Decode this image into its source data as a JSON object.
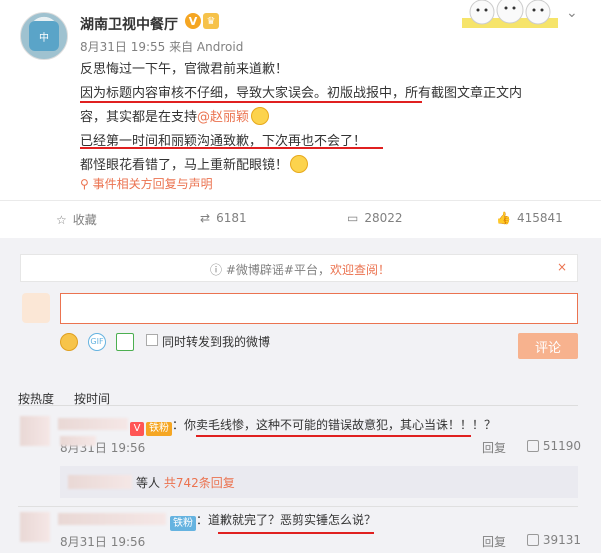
{
  "header": {
    "account_name": "湖南卫视中餐厅",
    "verified_badge": "V",
    "meta": "8月31日 19:55 来自 Android",
    "menu_icon": "chevron-down-icon"
  },
  "post": {
    "lines": [
      "反思悔过一下午，官微君前来道歉！",
      "因为标题内容审核不仔细，导致大家误会。初版战报中，所有截图文章正文内",
      "容，其实都是在支持",
      "已经第一时间和丽颖沟通致歉，下次再也不会了！",
      "都怪眼花看错了，马上重新配眼镜！"
    ],
    "mention": "@赵丽颖",
    "related_link": "事件相关方回复与声明"
  },
  "actions": {
    "favorite": "收藏",
    "repost": "6181",
    "comments": "28022",
    "likes": "415841"
  },
  "notice": {
    "prefix": "#微博辟谣#平台，",
    "highlight": "欢迎查阅！",
    "close": "×"
  },
  "composer": {
    "forward_label": "同时转发到我的微博",
    "submit_label": "评论"
  },
  "sort": {
    "hot": "按热度",
    "time": "按时间"
  },
  "comments": [
    {
      "badge": "V",
      "fan_tag": "铁粉",
      "text": "你卖毛线惨，这种不可能的错误故意犯，其心当诛！！！？",
      "time": "8月31日 19:56",
      "reply_label": "回复",
      "likes": "51190"
    },
    {
      "fan_tag": "铁粉",
      "text": "道歉就完了？恶剪实锤怎么说？",
      "time": "8月31日 19:56",
      "reply_label": "回复",
      "likes": "39131"
    }
  ],
  "sub_reply": {
    "prefix": "等人",
    "count": "共742条回复"
  },
  "colors": {
    "accent": "#eb7350",
    "annotation_red": "#e02020",
    "background": "#f2f2f5"
  }
}
